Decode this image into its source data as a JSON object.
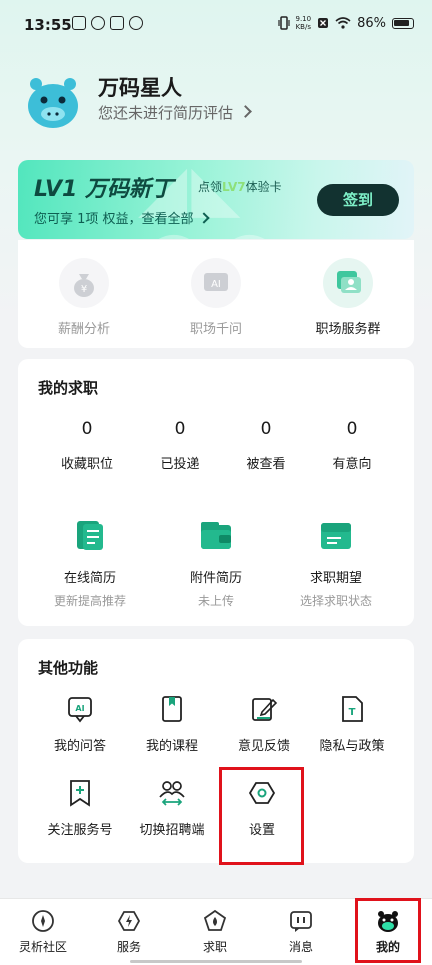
{
  "status_bar": {
    "time": "13:55",
    "speed_value": "9.10",
    "speed_unit": "KB/s",
    "battery": "86%"
  },
  "profile": {
    "name": "万码星人",
    "subtitle": "您还未进行简历评估"
  },
  "vip_card": {
    "level_title": "LV1 万码新丁",
    "trial_prefix": "点领",
    "trial_level": "LV7",
    "trial_suffix": "体验卡",
    "benefit_text": "您可享 1项 权益，查看全部",
    "signin_label": "签到",
    "accent_color": "#52e6bd"
  },
  "tools": [
    {
      "label": "薪酬分析",
      "icon": "money-bag-icon"
    },
    {
      "label": "职场千问",
      "icon": "ai-icon"
    },
    {
      "label": "职场服务群",
      "icon": "group-chat-icon"
    }
  ],
  "job_search": {
    "title": "我的求职",
    "stats": [
      {
        "value": "0",
        "label": "收藏职位"
      },
      {
        "value": "0",
        "label": "已投递"
      },
      {
        "value": "0",
        "label": "被查看"
      },
      {
        "value": "0",
        "label": "有意向"
      }
    ],
    "resume_items": [
      {
        "label": "在线简历",
        "sub": "更新提高推荐",
        "icon": "online-resume-icon"
      },
      {
        "label": "附件简历",
        "sub": "未上传",
        "icon": "attachment-resume-icon"
      },
      {
        "label": "求职期望",
        "sub": "选择求职状态",
        "icon": "job-expectation-icon"
      }
    ]
  },
  "other_functions": {
    "title": "其他功能",
    "items": [
      {
        "label": "我的问答",
        "icon": "ai-chat-icon"
      },
      {
        "label": "我的课程",
        "icon": "bookmark-book-icon"
      },
      {
        "label": "意见反馈",
        "icon": "feedback-edit-icon"
      },
      {
        "label": "隐私与政策",
        "icon": "privacy-document-icon"
      },
      {
        "label": "关注服务号",
        "icon": "follow-account-icon"
      },
      {
        "label": "切换招聘端",
        "icon": "switch-users-icon"
      },
      {
        "label": "设置",
        "icon": "settings-hexagon-icon"
      }
    ]
  },
  "tab_bar": {
    "items": [
      {
        "label": "灵析社区",
        "icon": "community-icon"
      },
      {
        "label": "服务",
        "icon": "service-lightning-icon"
      },
      {
        "label": "求职",
        "icon": "job-pentagon-icon"
      },
      {
        "label": "消息",
        "icon": "message-icon"
      },
      {
        "label": "我的",
        "icon": "me-mascot-icon"
      }
    ],
    "active": "我的",
    "accent_color": "#00b38a"
  }
}
